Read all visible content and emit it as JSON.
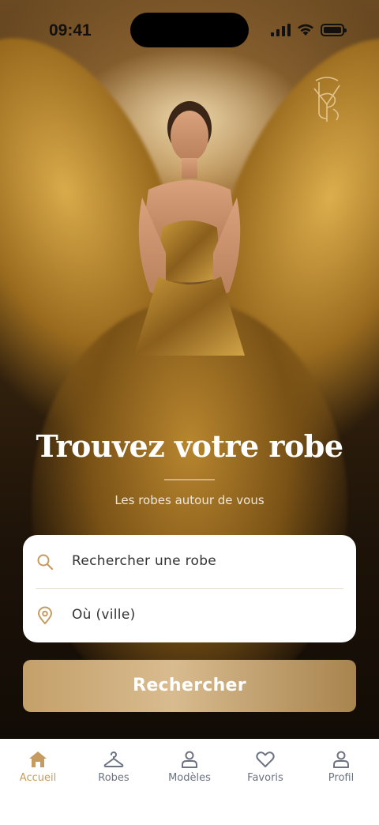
{
  "status_bar": {
    "time": "09:41"
  },
  "hero": {
    "title": "Trouvez votre robe",
    "subtitle": "Les robes autour de vous"
  },
  "search": {
    "dress_placeholder": "Rechercher une robe",
    "city_placeholder": "Où (ville)",
    "submit_label": "Rechercher"
  },
  "tabs": [
    {
      "label": "Accueil",
      "icon": "home-icon",
      "active": true
    },
    {
      "label": "Robes",
      "icon": "hanger-icon",
      "active": false
    },
    {
      "label": "Modèles",
      "icon": "person-icon",
      "active": false
    },
    {
      "label": "Favoris",
      "icon": "heart-icon",
      "active": false
    },
    {
      "label": "Profil",
      "icon": "user-icon",
      "active": false
    }
  ],
  "colors": {
    "accent": "#c59b5f",
    "inactive": "#6b7280",
    "button_start": "#c4a06a",
    "button_end": "#a8844e"
  }
}
